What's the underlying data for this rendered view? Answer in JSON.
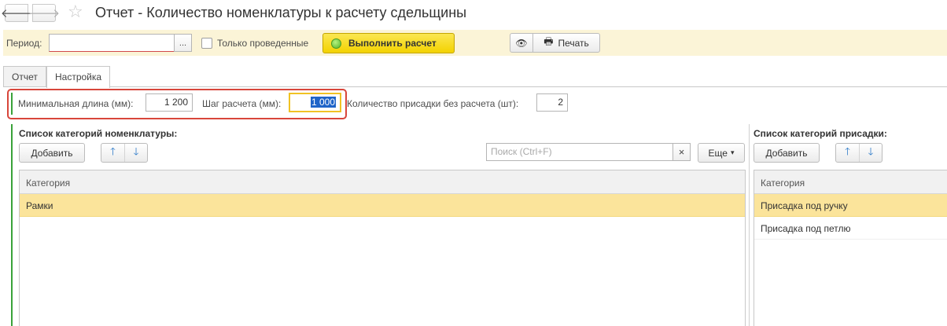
{
  "window": {
    "title": "Отчет - Количество номенклатуры к расчету сдельщины",
    "back_icon": "🡐",
    "forward_icon": "🡒",
    "star_icon": "☆"
  },
  "command_bar": {
    "period_label": "Период:",
    "period_value": "",
    "pick_button": "...",
    "only_posted_label": "Только проведенные",
    "only_posted_checked": false,
    "run_button": "Выполнить расчет",
    "eye_icon": "👁",
    "print_icon": "🖶",
    "print_button": "Печать"
  },
  "tabs": [
    {
      "label": "Отчет",
      "active": false
    },
    {
      "label": "Настройка",
      "active": true
    }
  ],
  "settings": {
    "min_length_label": "Минимальная длина (мм):",
    "min_length_value": "1 200",
    "step_label": "Шаг расчета (мм):",
    "step_value": "1 000",
    "additive_label": "Количество присадки без расчета (шт):",
    "additive_value": "2"
  },
  "nomenclature": {
    "title": "Список категорий номенклатуры:",
    "add_button": "Добавить",
    "up_icon": "🡑",
    "down_icon": "🡓",
    "search_placeholder": "Поиск (Ctrl+F)",
    "clear_icon": "×",
    "more_button": "Еще",
    "more_chevron": "▾",
    "column_header": "Категория",
    "rows": [
      {
        "label": "Рамки",
        "selected": true
      }
    ]
  },
  "additives": {
    "title": "Список категорий присадки:",
    "add_button": "Добавить",
    "up_icon": "🡑",
    "down_icon": "🡓",
    "column_header": "Категория",
    "rows": [
      {
        "label": "Присадка под ручку",
        "selected": true
      },
      {
        "label": "Присадка под петлю",
        "selected": false
      }
    ]
  }
}
